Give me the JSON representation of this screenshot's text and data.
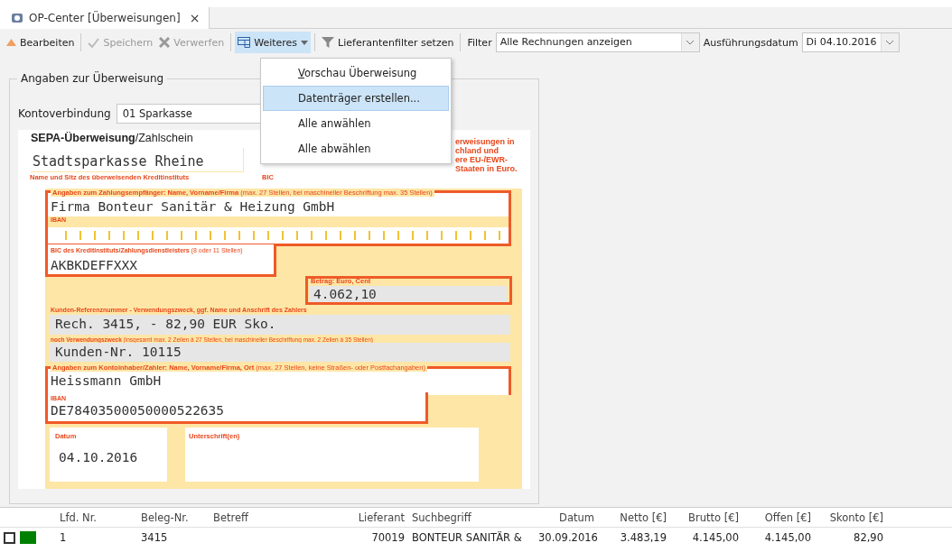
{
  "tabs": [
    {
      "label": "OP-Center [Überweisungen]",
      "selected": true,
      "close": "×"
    }
  ],
  "toolbar": [
    {
      "kind": "button",
      "label": "Bearbeiten",
      "disabled": false
    },
    {
      "kind": "button",
      "label": "Speichern",
      "disabled": true
    },
    {
      "kind": "button",
      "label": "Verwerfen",
      "disabled": true
    },
    {
      "kind": "menu",
      "label": "Weiteres",
      "disabled": false,
      "expanded": true
    },
    {
      "kind": "button",
      "label": "Lieferantenfilter setzen",
      "disabled": false
    },
    {
      "kind": "label",
      "label": "Filter"
    },
    {
      "kind": "combo",
      "value": "Alle Rechnungen anzeigen"
    },
    {
      "kind": "label",
      "label": "Ausführungsdatum"
    },
    {
      "kind": "combo",
      "value": "Di 04.10.2016"
    }
  ],
  "menu": [
    {
      "label": "**V**orschau Überweisung",
      "selected": false
    },
    {
      "label": "Datenträger erstellen...",
      "selected": true
    },
    {
      "label": "Alle anwählen",
      "selected": false
    },
    {
      "label": "Alle abwählen",
      "selected": false
    }
  ],
  "group": {
    "title": "Angaben zur Überweisung",
    "account_label": "Kontoverbindung",
    "account_value": "01 Sparkasse"
  },
  "form": {
    "title": "**SEPA-Überweisung**/Zahlschein",
    "note": [
      "erweisungen in",
      "chland und",
      "ere EU-/EWR-",
      "Staaten in Euro."
    ],
    "bank_name": "Stadtsparkasse Rheine",
    "bank_label": "Name und Sitz des überweisenden Kreditinstituts",
    "bic_label": "BIC",
    "payee_label": "Angaben zum Zahlungsempfänger: Name, Vorname/Firma *(max. 27 Stellen, bei maschineller Beschriftung max. 35 Stellen)*",
    "payee_name": "Firma Bonteur Sanitär & Heizung GmbH",
    "payee_iban_label": "IBAN",
    "payee_bic_label": "BIC des Kreditinstituts/Zahlungsdienstleisters *(8 oder 11 Stellen)*",
    "payee_bic": "AKBKDEFFXXX",
    "amount_label": "Betrag: Euro, Cent",
    "amount": "4.062,10",
    "reference_label": "Kunden-Referenznummer - Verwendungszweck, ggf. Name und Anschrift des Zahlers",
    "reference": "Rech. 3415, - 82,90 EUR Sko.",
    "purpose_label": "noch Verwendungszweck *(insgesamt max. 2 Zeilen à 27 Stellen, bei maschineller Beschriftung max. 2 Zeilen à 35 Stellen)*",
    "purpose": "Kunden-Nr. 10115",
    "payer_label": "Angaben zum Kontoinhaber/Zahler: Name, Vorname/Firma, Ort *(max. 27 Stellen, keine Straßen- oder Postfachangaben)*",
    "payer_name": "Heissmann GmbH",
    "payer_iban_label": "IBAN",
    "payer_iban": "DE78403500050000522635",
    "date_label": "Datum",
    "date": "04.10.2016",
    "signature_label": "Unterschrift(en)"
  },
  "table": {
    "columns": [
      "Lfd. Nr.",
      "Beleg-Nr.",
      "Betreff",
      "Lieferant",
      "Suchbegriff",
      "Datum",
      "Netto [€]",
      "Brutto [€]",
      "Offen [€]",
      "Skonto [€]"
    ],
    "rows": [
      {
        "checked": false,
        "color": "#008000",
        "cells": [
          "1",
          "3415",
          "",
          "70019",
          "BONTEUR SANITÄR &",
          "30.09.2016",
          "3.483,19",
          "4.145,00",
          "4.145,00",
          "82,90"
        ]
      }
    ]
  }
}
